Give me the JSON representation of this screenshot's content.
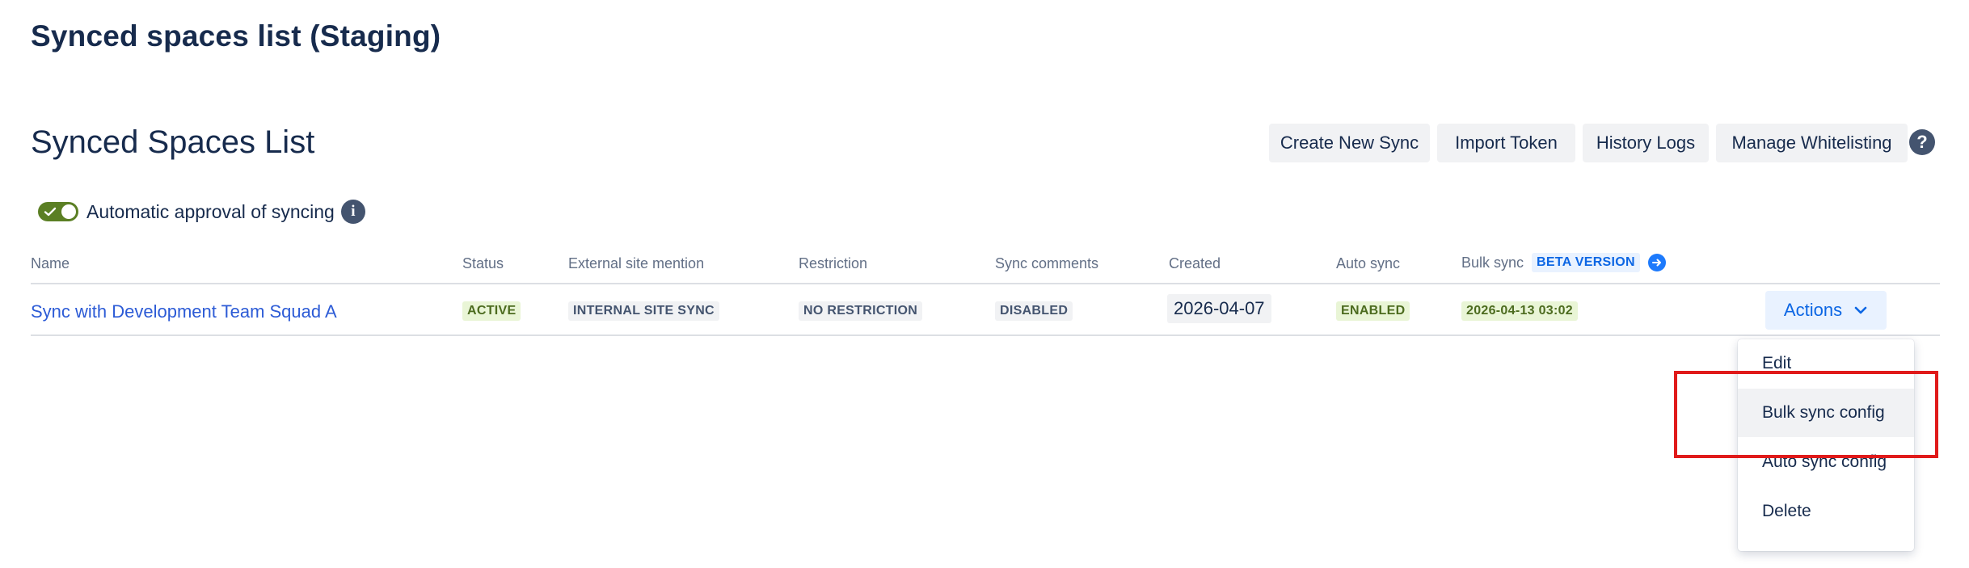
{
  "page": {
    "title": "Synced spaces list (Staging)"
  },
  "section": {
    "title": "Synced Spaces List"
  },
  "toolbar": {
    "buttons": [
      "Create New Sync",
      "Import Token",
      "History Logs",
      "Manage Whitelisting"
    ]
  },
  "auto_approval": {
    "label": "Automatic approval of syncing",
    "enabled": true
  },
  "table": {
    "headers": {
      "name": "Name",
      "status": "Status",
      "external": "External site mention",
      "restriction": "Restriction",
      "comments": "Sync comments",
      "created": "Created",
      "auto_sync": "Auto sync",
      "bulk_sync": "Bulk sync",
      "bulk_sync_badge": "BETA VERSION"
    },
    "rows": [
      {
        "name": "Sync with Development Team Squad A",
        "status": "ACTIVE",
        "external": "INTERNAL SITE SYNC",
        "restriction": "NO RESTRICTION",
        "comments": "DISABLED",
        "created": "2026-04-07",
        "auto_sync": "ENABLED",
        "bulk_sync": "2026-04-13 03:02",
        "actions_label": "Actions"
      }
    ]
  },
  "actions_menu": {
    "items": [
      "Edit",
      "Bulk sync config",
      "Auto sync config",
      "Delete"
    ],
    "hovered": "Bulk sync config"
  },
  "colors": {
    "highlight": "#e01a1a",
    "link": "#2c5bd6",
    "toggle_on": "#5b7f24",
    "actions_bg": "#e9f2ff"
  },
  "icons": [
    "help-icon",
    "info-icon",
    "check-icon",
    "chevron-down-icon",
    "arrow-right-circle-icon"
  ]
}
